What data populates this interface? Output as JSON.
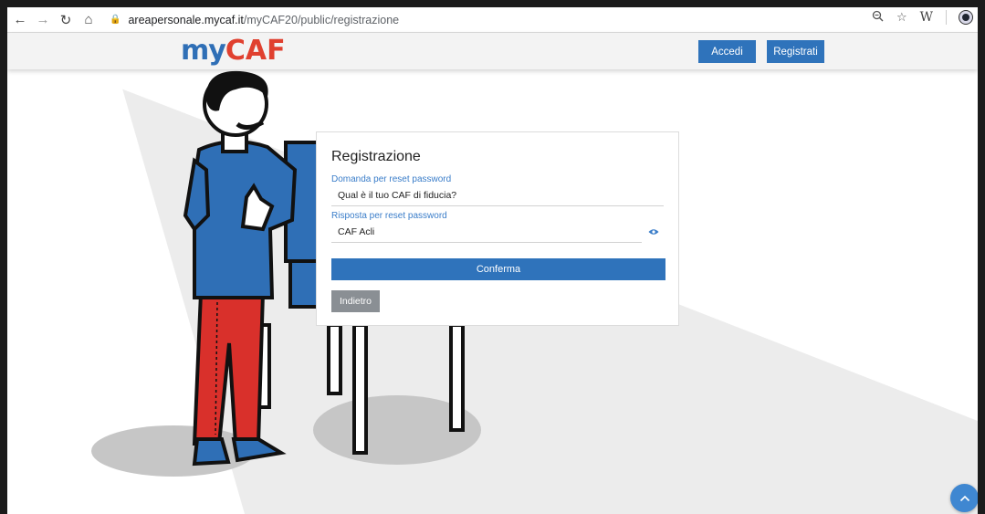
{
  "browser": {
    "url_host": "areapersonale.mycaf.it",
    "url_path": "/myCAF20/public/registrazione",
    "extension_label": "W"
  },
  "header": {
    "logo_my": "my",
    "logo_caf": "CAF",
    "accedi_label": "Accedi",
    "registrati_label": "Registrati"
  },
  "form": {
    "title": "Registrazione",
    "question_label": "Domanda per reset password",
    "question_value": "Qual è il tuo CAF di fiducia?",
    "answer_label": "Risposta per reset password",
    "answer_value": "CAF Acli",
    "confirm_label": "Conferma",
    "back_label": "Indietro"
  },
  "colors": {
    "brand_blue": "#2f73bb",
    "brand_red": "#e0402f",
    "label_blue": "#3a7dc9",
    "back_gray": "#8a8f94"
  },
  "icons": [
    "back-arrow-icon",
    "forward-arrow-icon",
    "reload-icon",
    "home-icon",
    "lock-icon",
    "zoom-icon",
    "star-icon",
    "eye-icon",
    "chevron-up-icon"
  ]
}
